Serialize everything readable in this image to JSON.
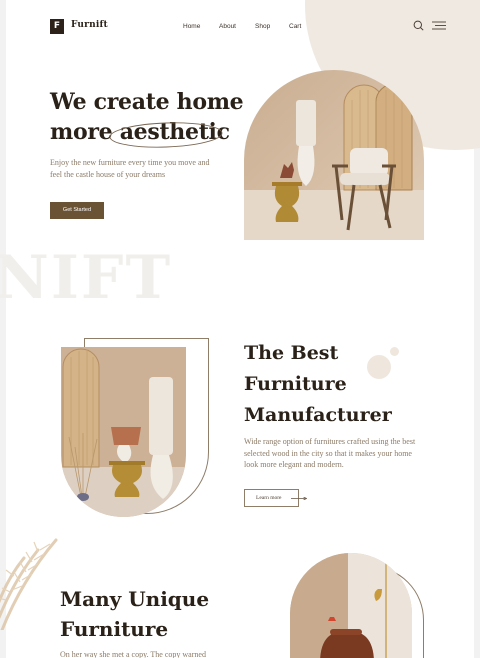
{
  "brand": {
    "logo_letter": "F",
    "name": "Furnift"
  },
  "nav": {
    "links": [
      {
        "label": "Home"
      },
      {
        "label": "About"
      },
      {
        "label": "Shop"
      },
      {
        "label": "Cart"
      }
    ],
    "icons": [
      "search-icon",
      "hamburger-menu-icon"
    ]
  },
  "hero": {
    "line1": "We create home",
    "line2_prefix": "more ",
    "line2_emphasis": "aesthetic",
    "description": "Enjoy the new furniture every time you move and feel the castle house of your dreams",
    "cta": "Get Started"
  },
  "watermark": "NIFT",
  "manufacturer": {
    "title_lines": [
      "The Best",
      "Furniture",
      "Manufacturer"
    ],
    "description": "Wide range option of furnitures crafted using the best selected wood in the city so that it makes your home look more elegant and modern.",
    "cta": "Learn more"
  },
  "unique": {
    "title_lines": [
      "Many Unique",
      "Furniture"
    ],
    "description": "On her way she met a copy. The copy warned"
  },
  "colors": {
    "accent_brown": "#6a5234",
    "text_dark": "#2a2118",
    "text_muted": "#8b7a66",
    "beige": "#efe9e1"
  }
}
